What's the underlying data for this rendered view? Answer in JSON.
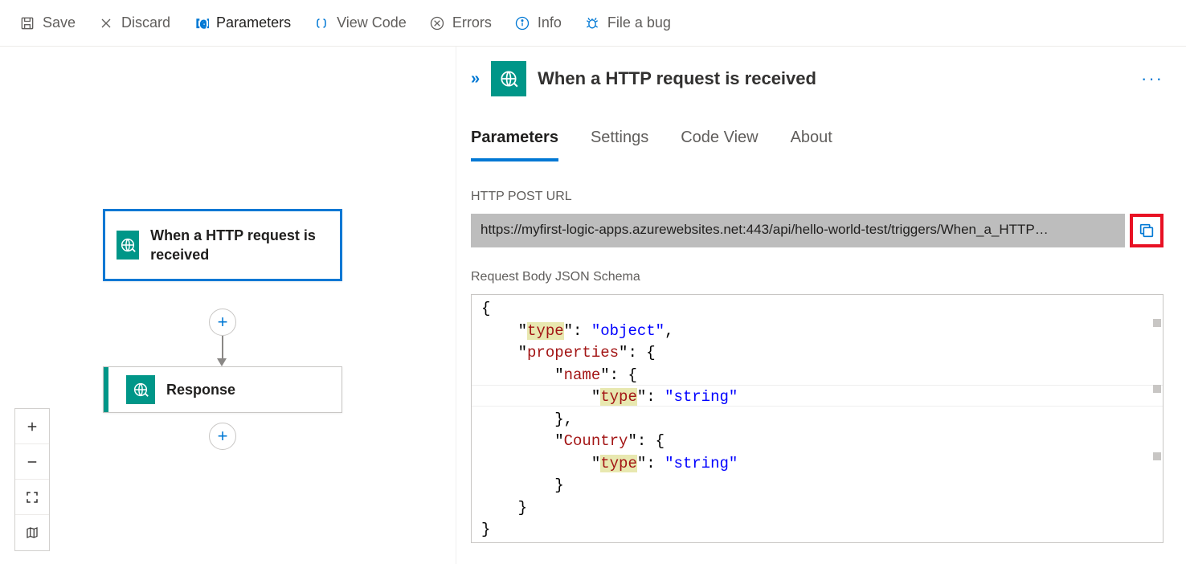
{
  "toolbar": {
    "save": "Save",
    "discard": "Discard",
    "parameters": "Parameters",
    "view_code": "View Code",
    "errors": "Errors",
    "info": "Info",
    "file_bug": "File a bug"
  },
  "workflow": {
    "trigger_label": "When a HTTP request is received",
    "response_label": "Response"
  },
  "panel": {
    "title": "When a HTTP request is received",
    "tabs": [
      "Parameters",
      "Settings",
      "Code View",
      "About"
    ],
    "active_tab": "Parameters",
    "url_label": "HTTP POST URL",
    "url_value": "https://myfirst-logic-apps.azurewebsites.net:443/api/hello-world-test/triggers/When_a_HTTP…",
    "schema_label": "Request Body JSON Schema",
    "schema": {
      "type": "object",
      "properties": {
        "name": {
          "type": "string"
        },
        "Country": {
          "type": "string"
        }
      }
    }
  }
}
